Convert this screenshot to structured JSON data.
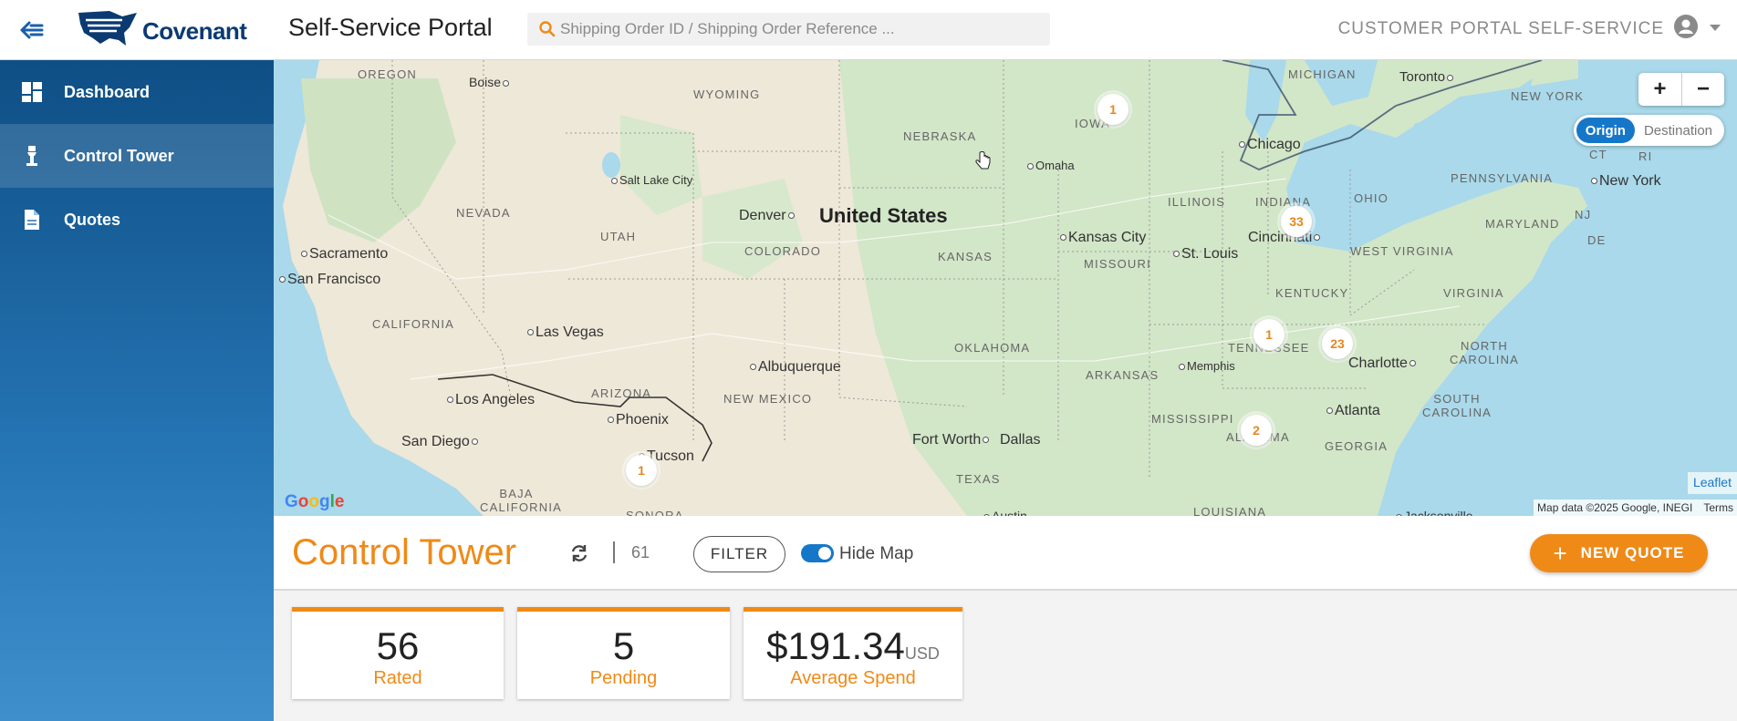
{
  "header": {
    "brand": "Covenant",
    "app_title": "Self-Service Portal",
    "search_placeholder": "Shipping Order ID / Shipping Order Reference ...",
    "portal_label": "CUSTOMER PORTAL SELF-SERVICE"
  },
  "sidebar": {
    "items": [
      {
        "label": "Dashboard",
        "icon": "dashboard-icon",
        "active": false
      },
      {
        "label": "Control Tower",
        "icon": "control-tower-icon",
        "active": true
      },
      {
        "label": "Quotes",
        "icon": "document-icon",
        "active": false
      }
    ]
  },
  "map": {
    "country": "United States",
    "states": [
      "OREGON",
      "WYOMING",
      "NEBRASKA",
      "IOWA",
      "MICHIGAN",
      "NEW YORK",
      "NEVADA",
      "UTAH",
      "COLORADO",
      "KANSAS",
      "MISSOURI",
      "ILLINOIS",
      "INDIANA",
      "OHIO",
      "PENNSYLVANIA",
      "MARYLAND",
      "WEST VIRGINIA",
      "VIRGINIA",
      "KENTUCKY",
      "CALIFORNIA",
      "ARIZONA",
      "NEW MEXICO",
      "OKLAHOMA",
      "ARKANSAS",
      "TENNESSEE",
      "NORTH CAROLINA",
      "SOUTH CAROLINA",
      "MISSISSIPPI",
      "GEORGIA",
      "TEXAS",
      "BAJA CALIFORNIA",
      "LOUISIANA",
      "SONORA",
      "ALABAMA",
      "DE",
      "CT",
      "RI",
      "NJ"
    ],
    "cities": [
      "Boise",
      "Toronto",
      "Chicago",
      "Omaha",
      "Salt Lake City",
      "Denver",
      "New York",
      "Kansas City",
      "St. Louis",
      "Cincinnati",
      "Sacramento",
      "San Francisco",
      "Las Vegas",
      "Albuquerque",
      "Memphis",
      "Charlotte",
      "Los Angeles",
      "Phoenix",
      "Atlanta",
      "San Diego",
      "Tucson",
      "Fort Worth",
      "Dallas",
      "Austin",
      "Jacksonville"
    ],
    "clusters": [
      {
        "label": "1",
        "near": "Iowa"
      },
      {
        "label": "33",
        "near": "Indiana"
      },
      {
        "label": "1",
        "near": "Tennessee"
      },
      {
        "label": "23",
        "near": "Tennessee east"
      },
      {
        "label": "2",
        "near": "Alabama"
      },
      {
        "label": "1",
        "near": "Tucson"
      }
    ],
    "zoom_in": "+",
    "zoom_out": "−",
    "origin_label": "Origin",
    "destination_label": "Destination",
    "selected_mode": "Origin",
    "leaflet_attr": "Leaflet",
    "map_data_attr": "Map data ©2025 Google, INEGI",
    "terms": "Terms",
    "google": "Google"
  },
  "control_tower": {
    "title": "Control Tower",
    "count": "61",
    "filter_label": "FILTER",
    "hide_map_label": "Hide Map",
    "hide_map_on": true,
    "new_quote_label": "NEW QUOTE"
  },
  "cards": [
    {
      "value": "56",
      "unit": "",
      "label": "Rated"
    },
    {
      "value": "5",
      "unit": "",
      "label": "Pending"
    },
    {
      "value": "$191.34",
      "unit": "USD",
      "label": "Average Spend"
    }
  ],
  "colors": {
    "accent": "#ef8a17",
    "primary": "#1677c9",
    "sidebar_dark": "#0e4f85"
  }
}
